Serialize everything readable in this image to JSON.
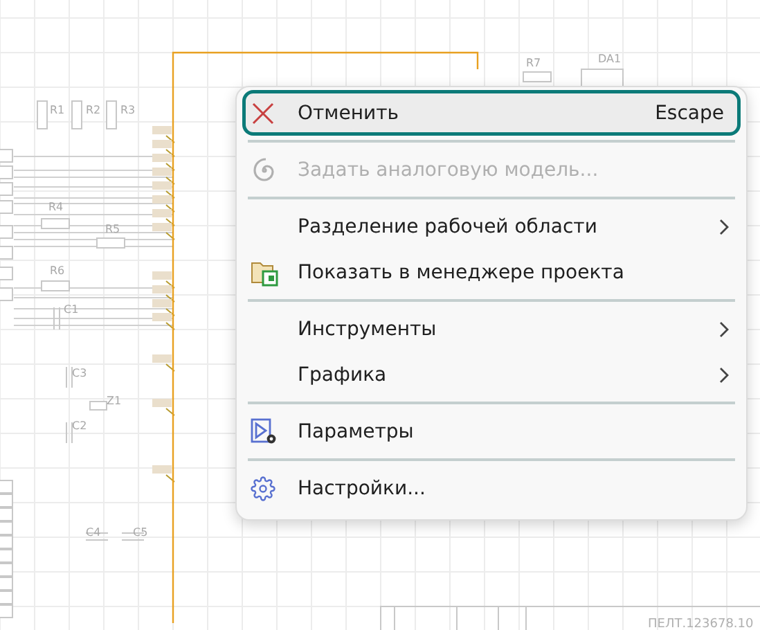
{
  "schematic": {
    "labels": [
      "R1",
      "R2",
      "R3",
      "R4",
      "R5",
      "R6",
      "C1",
      "C3",
      "Z1",
      "C2",
      "C4",
      "C5",
      "R7",
      "DA1"
    ],
    "stamp": "ПЕЛТ.123678.10"
  },
  "context_menu": {
    "items": [
      {
        "kind": "item",
        "label": "Отменить",
        "shortcut": "Escape",
        "selected": true,
        "disabled": false,
        "submenu": false
      },
      {
        "kind": "separator"
      },
      {
        "kind": "item",
        "label": "Задать аналоговую модель...",
        "selected": false,
        "disabled": true,
        "submenu": false
      },
      {
        "kind": "separator"
      },
      {
        "kind": "item",
        "label": "Разделение рабочей области",
        "selected": false,
        "disabled": false,
        "submenu": true
      },
      {
        "kind": "item",
        "label": "Показать в менеджере проекта",
        "selected": false,
        "disabled": false,
        "submenu": false
      },
      {
        "kind": "separator"
      },
      {
        "kind": "item",
        "label": "Инструменты",
        "selected": false,
        "disabled": false,
        "submenu": true
      },
      {
        "kind": "item",
        "label": "Графика",
        "selected": false,
        "disabled": false,
        "submenu": true
      },
      {
        "kind": "separator"
      },
      {
        "kind": "item",
        "label": "Параметры",
        "selected": false,
        "disabled": false,
        "submenu": false
      },
      {
        "kind": "separator"
      },
      {
        "kind": "item",
        "label": "Настройки...",
        "selected": false,
        "disabled": false,
        "submenu": false
      }
    ]
  }
}
